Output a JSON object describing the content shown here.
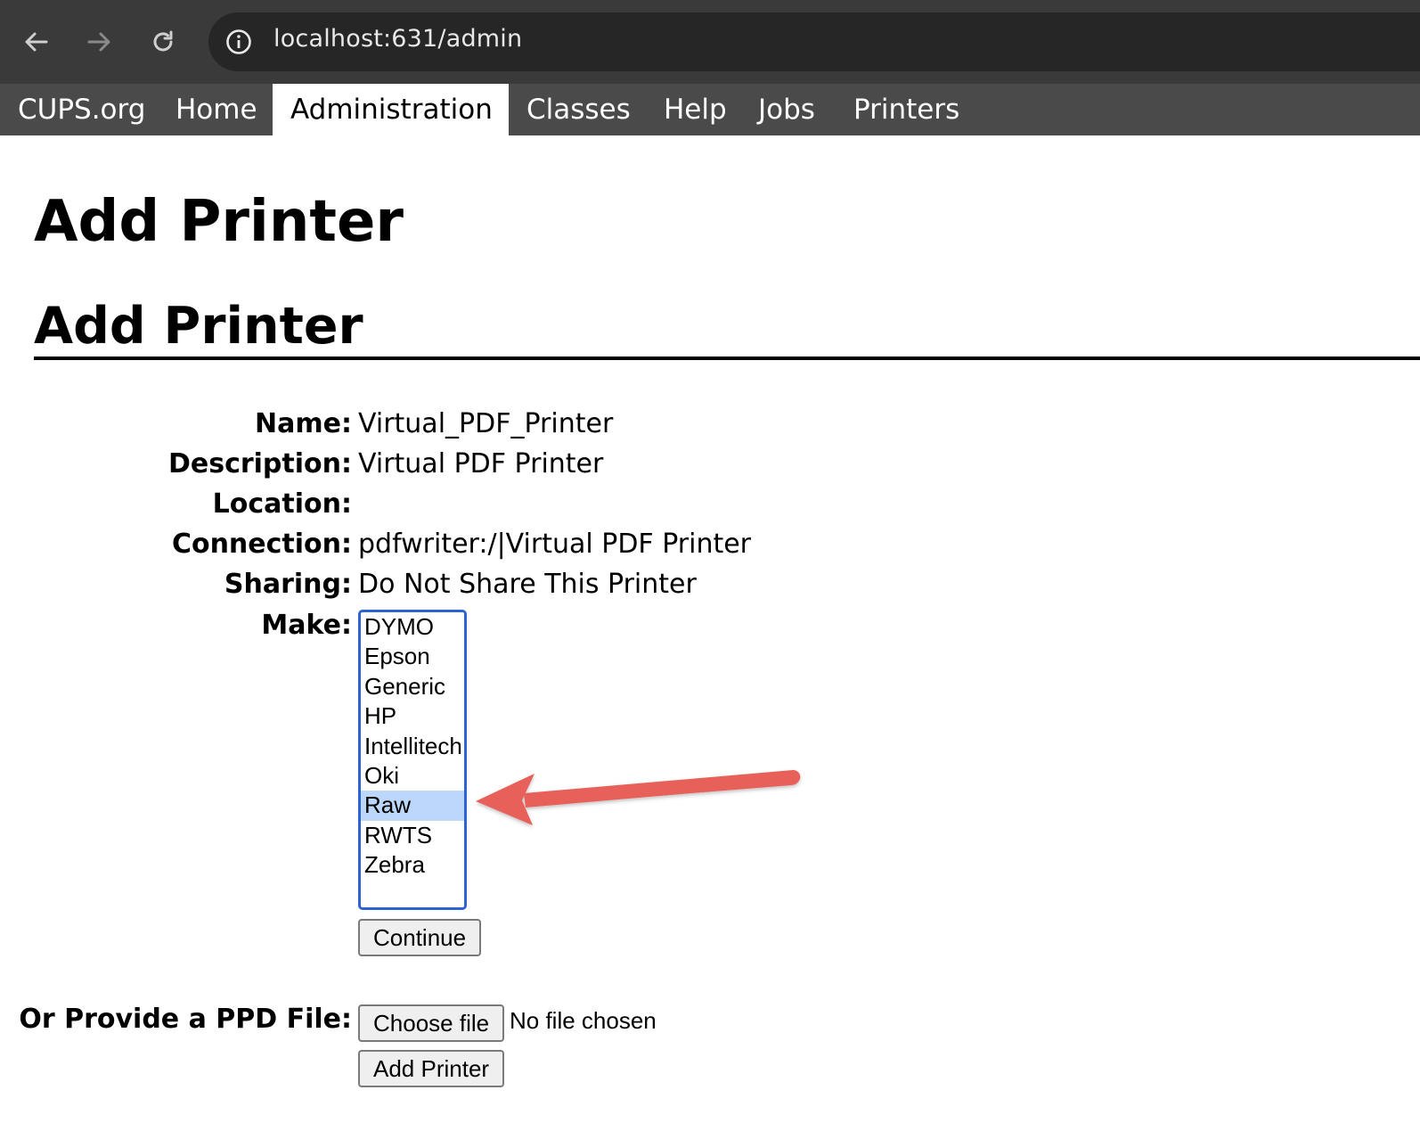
{
  "browser": {
    "url": "localhost:631/admin",
    "icons": [
      "back-arrow-icon",
      "forward-arrow-icon",
      "reload-icon",
      "info-icon"
    ]
  },
  "nav": {
    "tabs": [
      {
        "label": "CUPS.org"
      },
      {
        "label": "Home"
      },
      {
        "label": "Administration",
        "active": true
      },
      {
        "label": "Classes"
      },
      {
        "label": "Help"
      },
      {
        "label": "Jobs"
      },
      {
        "label": "Printers"
      }
    ]
  },
  "page": {
    "title": "Add Printer",
    "section_title": "Add Printer"
  },
  "form": {
    "name_label": "Name:",
    "name_value": "Virtual_PDF_Printer",
    "description_label": "Description:",
    "description_value": "Virtual PDF Printer",
    "location_label": "Location:",
    "location_value": "",
    "connection_label": "Connection:",
    "connection_value": "pdfwriter:/|Virtual PDF Printer",
    "sharing_label": "Sharing:",
    "sharing_value": "Do Not Share This Printer",
    "make_label": "Make:",
    "make_options": [
      "DYMO",
      "Epson",
      "Generic",
      "HP",
      "Intellitech",
      "Oki",
      "Raw",
      "RWTS",
      "Zebra"
    ],
    "make_selected": "Raw",
    "continue_label": "Continue",
    "ppd_label": "Or Provide a PPD File:",
    "choose_file_label": "Choose file",
    "no_file_text": "No file chosen",
    "add_printer_label": "Add Printer"
  },
  "annotation": {
    "arrow_color": "#e8605a",
    "icon": "red-arrow-annotation"
  },
  "colors": {
    "browser_bg": "#3a3a3a",
    "url_bar_bg": "#262626",
    "nav_bg": "#4a4a4a",
    "select_border": "#2d63d3",
    "selected_option_bg": "#bcd7fa"
  }
}
